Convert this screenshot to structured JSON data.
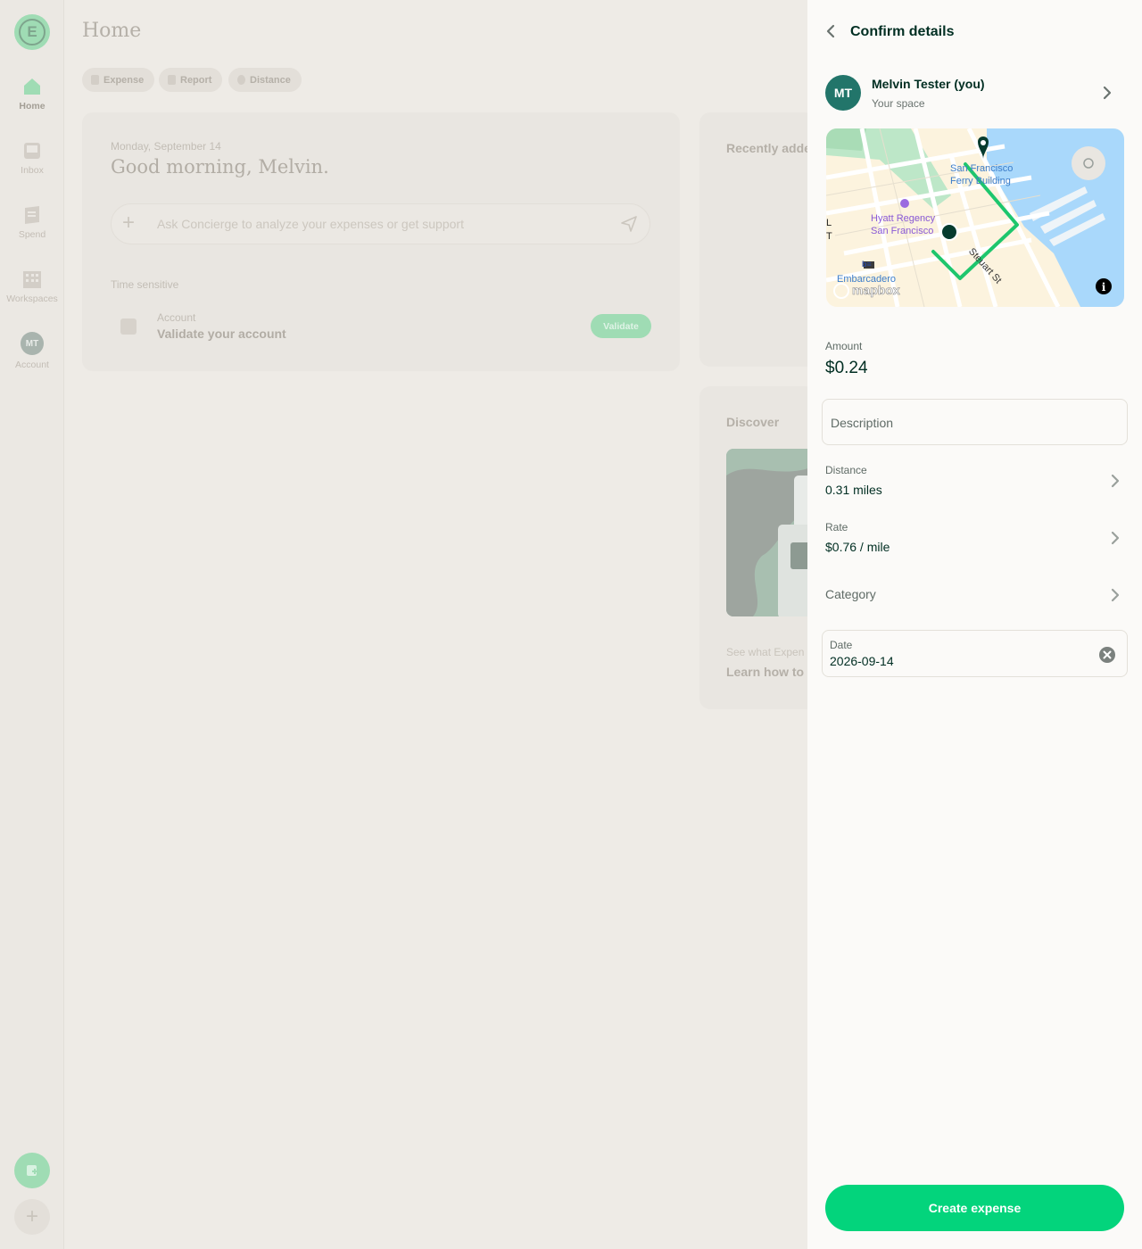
{
  "nav": {
    "logo_letter": "E",
    "items": [
      {
        "label": "Home",
        "icon": "home-icon"
      },
      {
        "label": "Inbox",
        "icon": "inbox-icon"
      },
      {
        "label": "Spend",
        "icon": "receipt-icon"
      },
      {
        "label": "Workspaces",
        "icon": "building-icon"
      },
      {
        "label": "Account",
        "icon": "avatar",
        "initials": "MT"
      }
    ],
    "fab_plus": "+"
  },
  "home": {
    "title": "Home",
    "chips": [
      "Expense",
      "Report",
      "Distance"
    ],
    "date": "Monday, September 14",
    "greeting": "Good morning, Melvin.",
    "ask_plus": "+",
    "ask_placeholder": "Ask Concierge to analyze your expenses or get support",
    "time_sensitive_label": "Time sensitive",
    "account_small": "Account",
    "account_title": "Validate your account",
    "validate_label": "Validate",
    "recently_added": "Recently adde",
    "discover": "Discover",
    "see_what": "See what Expen",
    "learn_how": "Learn how to"
  },
  "panel": {
    "title": "Confirm details",
    "user": {
      "initials": "MT",
      "name": "Melvin Tester (you)",
      "subtitle": "Your space"
    },
    "map": {
      "labels": {
        "ferry": [
          "San Francisco",
          "Ferry Building"
        ],
        "hyatt": [
          "Hyatt Regency",
          "San Francisco"
        ],
        "embarcadero": "Embarcadero",
        "street": "Steuart St",
        "attribution": "mapbox",
        "edge_l": "L",
        "edge_r": "T",
        "bart": "b≡"
      },
      "colors": {
        "route": "#1ec66d",
        "water": "#a9d8fb",
        "land": "#fcf3de",
        "park": "#bde7c8"
      }
    },
    "amount_label": "Amount",
    "amount_value": "$0.24",
    "description_placeholder": "Description",
    "distance_label": "Distance",
    "distance_value": "0.31 miles",
    "rate_label": "Rate",
    "rate_value": "$0.76 / mile",
    "category_label": "Category",
    "date_label": "Date",
    "date_value": "2026-09-14",
    "create_button": "Create expense"
  },
  "colors": {
    "accent": "#03d47c",
    "text_dark": "#002e22",
    "avatar": "#22756a"
  }
}
